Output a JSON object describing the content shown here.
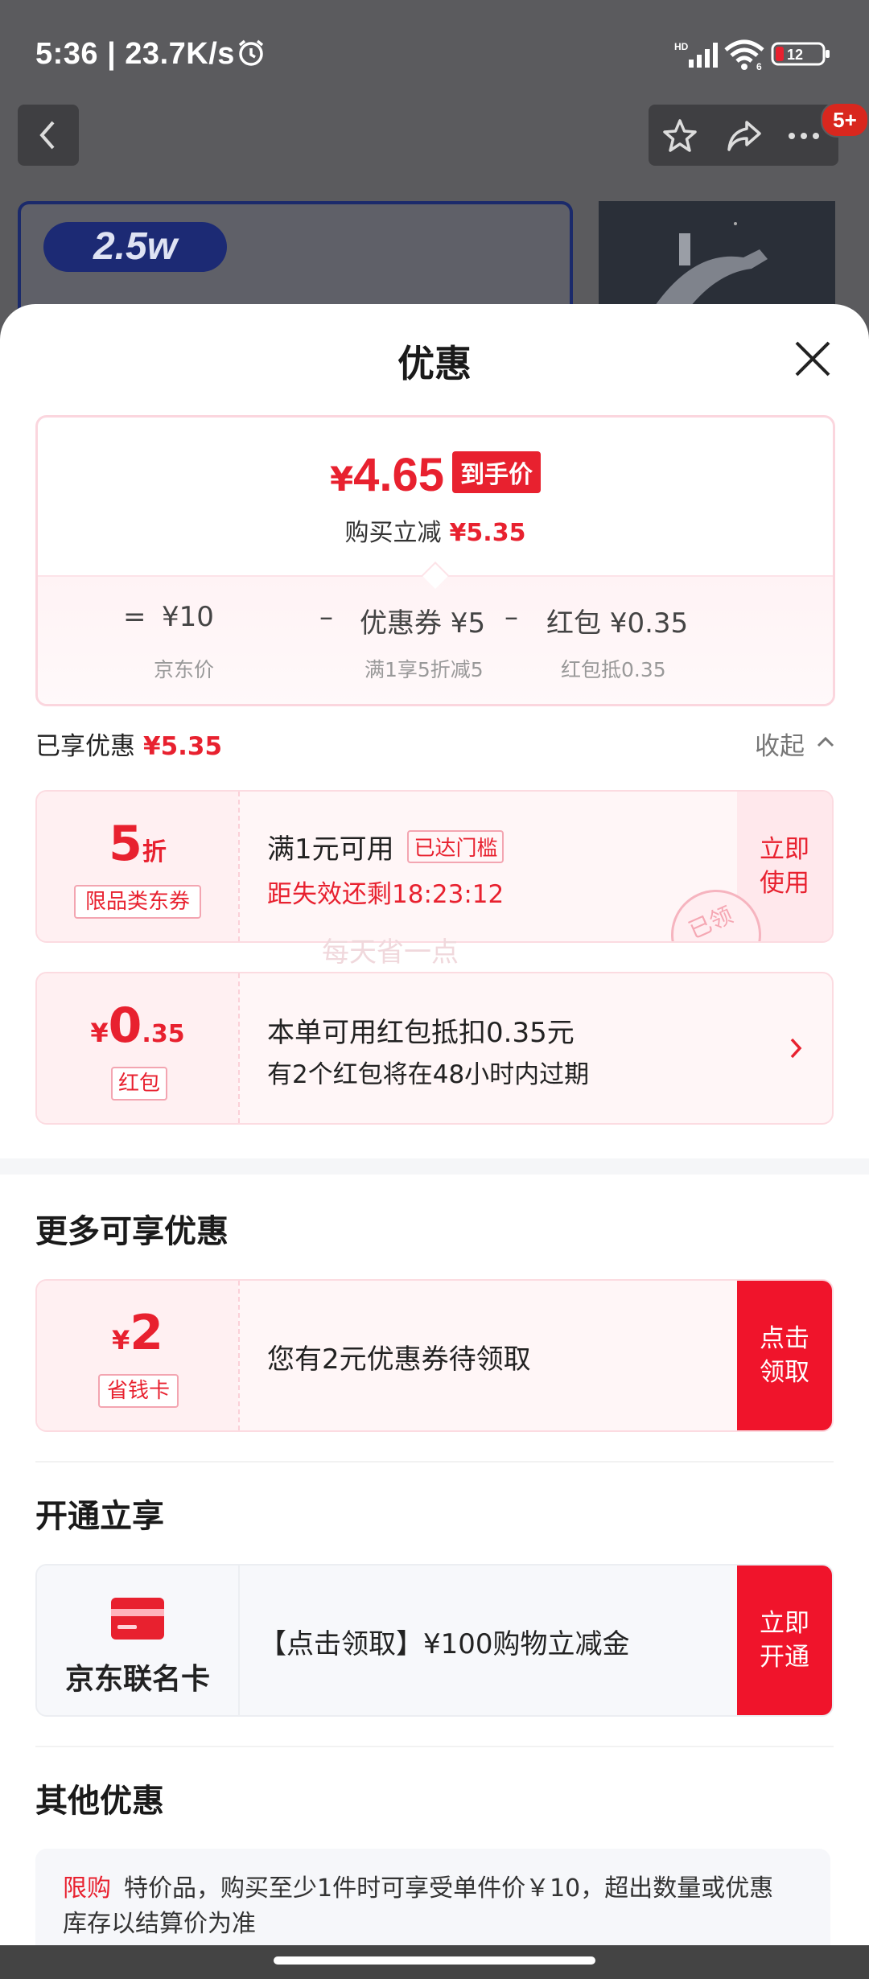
{
  "status_bar": {
    "time": "5:36 | 23.7K/s",
    "battery": "12",
    "network": "HD",
    "wifi_sub": "6"
  },
  "header": {
    "more_badge": "5+"
  },
  "thumb": {
    "tag": "2.5w"
  },
  "sheet": {
    "title": "优惠"
  },
  "price": {
    "currency": "¥",
    "final": "4.65",
    "final_label": "到手价",
    "reduce_text": "购买立减",
    "reduce_amount": "¥5.35",
    "eq": "=",
    "minus": "–",
    "base": "¥10",
    "base_caption": "京东价",
    "coupon": "优惠券 ¥5",
    "coupon_caption": "满1享5折减5",
    "redpacket": "红包 ¥0.35",
    "redpacket_caption": "红包抵0.35"
  },
  "enjoyed": {
    "label": "已享优惠",
    "amount": "¥5.35",
    "collapse": "收起"
  },
  "coupon_card": {
    "value": "5",
    "unit": "折",
    "tag": "限品类东券",
    "line1": "满1元可用",
    "threshold_badge": "已达门槛",
    "line2": "距失效还剩18:23:12",
    "button_line1": "立即",
    "button_line2": "使用",
    "stamp": "已领"
  },
  "watermark": "每天省一点",
  "red_card": {
    "currency": "¥",
    "value_int": "0",
    "value_dec": ".35",
    "tag": "红包",
    "line1": "本单可用红包抵扣0.35元",
    "line2": "有2个红包将在48小时内过期"
  },
  "more_section": {
    "title": "更多可享优惠",
    "currency": "¥",
    "value": "2",
    "tag": "省钱卡",
    "text": "您有2元优惠券待领取",
    "button_line1": "点击",
    "button_line2": "领取"
  },
  "open_section": {
    "title": "开通立享",
    "card_name": "京东联名卡",
    "text": "【点击领取】¥100购物立减金",
    "button_line1": "立即",
    "button_line2": "开通"
  },
  "other_section": {
    "title": "其他优惠",
    "tag": "限购",
    "text": "特价品，购买至少1件时可享受单件价￥10，超出数量或优惠库存以结算价为准"
  },
  "colors": {
    "accent": "#e8212f",
    "card_bg": "#fff6f7",
    "overlay": "#5b5b5e"
  }
}
